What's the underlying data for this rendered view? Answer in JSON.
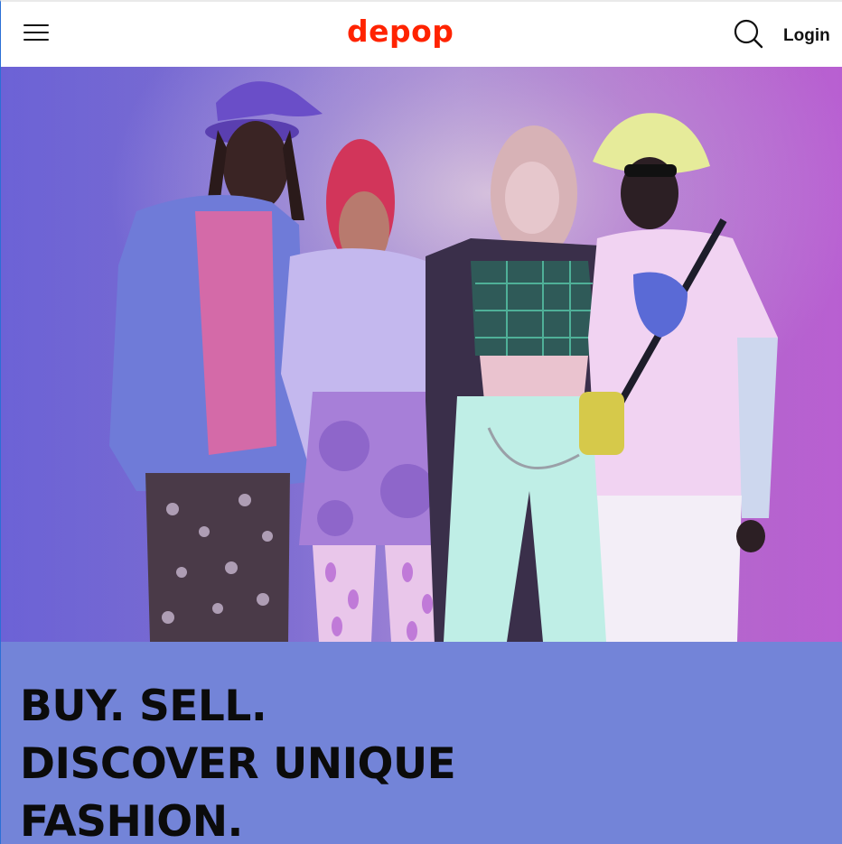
{
  "header": {
    "menu_icon": "hamburger-menu-icon",
    "logo_text": "depop",
    "search_icon": "search-icon",
    "login_label": "Login"
  },
  "hero": {
    "image_alt": "Four people posing in colorful streetwear",
    "headline_lines": [
      "BUY. SELL.",
      "DISCOVER UNIQUE",
      "FASHION."
    ]
  },
  "colors": {
    "brand_red": "#ff2300",
    "hero_panel_bg": "#7384d8",
    "headline_text": "#0b0b0b"
  }
}
